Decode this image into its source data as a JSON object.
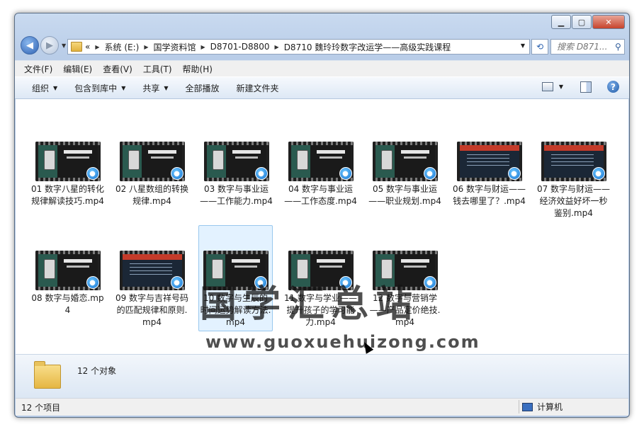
{
  "window": {
    "caption": {
      "minimize": "▁",
      "maximize": "▢",
      "close": "✕"
    }
  },
  "nav": {
    "back_icon": "back-arrow-icon",
    "forward_icon": "forward-arrow-icon"
  },
  "address": {
    "overflow": "«",
    "crumbs": [
      "系统 (E:)",
      "国学资料馆",
      "D8701-D8800",
      "D8710 魏玲玲数字改运学——高级实践课程"
    ]
  },
  "search": {
    "placeholder": "搜索 D871..."
  },
  "menu": [
    "文件(F)",
    "编辑(E)",
    "查看(V)",
    "工具(T)",
    "帮助(H)"
  ],
  "toolbar": {
    "organize": "组织",
    "include_library": "包含到库中",
    "share": "共享",
    "play_all": "全部播放",
    "new_folder": "新建文件夹"
  },
  "files": [
    {
      "name": "01 数字八星的转化规律解读技巧.mp4",
      "thumb": "video"
    },
    {
      "name": "02 八星数组的转换规律.mp4",
      "thumb": "video"
    },
    {
      "name": "03 数字与事业运——工作能力.mp4",
      "thumb": "video"
    },
    {
      "name": "04 数字与事业运——工作态度.mp4",
      "thumb": "video"
    },
    {
      "name": "05 数字与事业运——职业规划.mp4",
      "thumb": "video"
    },
    {
      "name": "06 数字与财运——钱去哪里了？.mp4",
      "thumb": "slide"
    },
    {
      "name": "07 数字与财运——经济效益好坏一秒鉴别.mp4",
      "thumb": "slide"
    },
    {
      "name": "08 数字与婚恋.mp4",
      "thumb": "video"
    },
    {
      "name": "09 数字与吉祥号码的匹配规律和原则.mp4",
      "thumb": "slide"
    },
    {
      "name": "10 数字与生辰的时间运势解读方法.mp4",
      "thumb": "video",
      "selected": true
    },
    {
      "name": "11 数字与学业——提升孩子的学习能力.mp4",
      "thumb": "video"
    },
    {
      "name": "12 数字与营销学——产品定价绝技.mp4",
      "thumb": "video"
    }
  ],
  "details": {
    "object_count": "12 个对象"
  },
  "status": {
    "items": "12 个项目",
    "location": "计算机"
  },
  "watermark": {
    "text": "国学汇总站",
    "url": "www.guoxuehuizong.com"
  },
  "colors": {
    "accent": "#2f62b3",
    "selection": "#cce8ff"
  }
}
